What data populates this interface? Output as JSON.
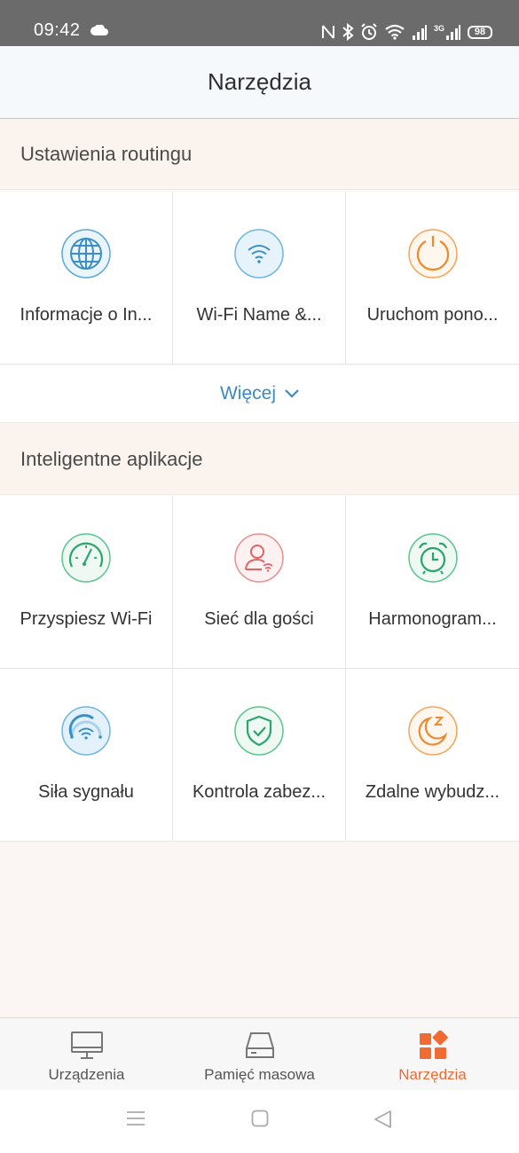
{
  "status": {
    "time": "09:42",
    "battery": "98",
    "network": "3G"
  },
  "header": {
    "title": "Narzędzia"
  },
  "sections": [
    {
      "title": "Ustawienia routingu",
      "items": [
        {
          "label": "Informacje o In...",
          "icon": "globe-icon",
          "color": "#3a90c4"
        },
        {
          "label": "Wi-Fi Name &...",
          "icon": "wifi-icon",
          "color": "#3a90c4"
        },
        {
          "label": "Uruchom pono...",
          "icon": "power-icon",
          "color": "#ef8a2c"
        }
      ],
      "more_label": "Więcej"
    },
    {
      "title": "Inteligentne aplikacje",
      "items": [
        {
          "label": "Przyspiesz Wi-Fi",
          "icon": "speedometer-icon",
          "color": "#2aa56b"
        },
        {
          "label": "Sieć dla gości",
          "icon": "guest-user-icon",
          "color": "#e06464"
        },
        {
          "label": "Harmonogram...",
          "icon": "alarm-clock-icon",
          "color": "#2aa56b"
        },
        {
          "label": "Siła sygnału",
          "icon": "signal-strength-icon",
          "color": "#3a90c4"
        },
        {
          "label": "Kontrola zabez...",
          "icon": "shield-check-icon",
          "color": "#2aa56b"
        },
        {
          "label": "Zdalne wybudz...",
          "icon": "moon-sleep-icon",
          "color": "#ef8a2c"
        }
      ]
    }
  ],
  "tabs": [
    {
      "label": "Urządzenia",
      "icon": "monitor-icon"
    },
    {
      "label": "Pamięć masowa",
      "icon": "storage-drive-icon"
    },
    {
      "label": "Narzędzia",
      "icon": "tools-grid-icon",
      "active": true
    }
  ],
  "colors": {
    "accent": "#f06a33",
    "link": "#3a8bbf",
    "status_bar": "#6b6b6b"
  }
}
